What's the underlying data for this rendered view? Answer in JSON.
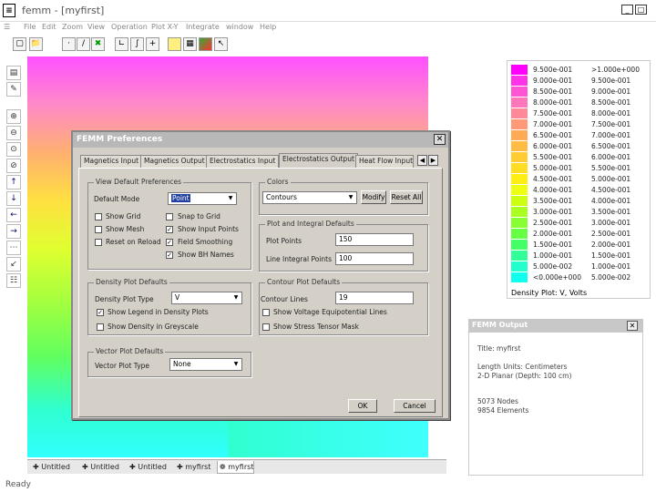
{
  "window": {
    "title": "femm - [myfirst]",
    "status": "Ready"
  },
  "menu": [
    "File",
    "Edit",
    "Zoom",
    "View",
    "Operation",
    "Plot X-Y",
    "Integrate",
    "window",
    "Help"
  ],
  "document_tabs": [
    "Untitled",
    "Untitled",
    "Untitled",
    "myfirst",
    "myfirst"
  ],
  "legend": {
    "rows": [
      {
        "low": "9.500e-001",
        "high": ">1.000e+000",
        "color": "#ff00ff"
      },
      {
        "low": "9.000e-001",
        "high": "9.500e-001",
        "color": "#ff33e8"
      },
      {
        "low": "8.500e-001",
        "high": "9.000e-001",
        "color": "#ff55d5"
      },
      {
        "low": "8.000e-001",
        "high": "8.500e-001",
        "color": "#ff77bb"
      },
      {
        "low": "7.500e-001",
        "high": "8.000e-001",
        "color": "#ff8899"
      },
      {
        "low": "7.000e-001",
        "high": "7.500e-001",
        "color": "#ff9977"
      },
      {
        "low": "6.500e-001",
        "high": "7.000e-001",
        "color": "#ffaa55"
      },
      {
        "low": "6.000e-001",
        "high": "6.500e-001",
        "color": "#ffbb44"
      },
      {
        "low": "5.500e-001",
        "high": "6.000e-001",
        "color": "#ffcc33"
      },
      {
        "low": "5.000e-001",
        "high": "5.500e-001",
        "color": "#ffdd22"
      },
      {
        "low": "4.500e-001",
        "high": "5.000e-001",
        "color": "#ffee11"
      },
      {
        "low": "4.000e-001",
        "high": "4.500e-001",
        "color": "#eeff11"
      },
      {
        "low": "3.500e-001",
        "high": "4.000e-001",
        "color": "#ccff11"
      },
      {
        "low": "3.000e-001",
        "high": "3.500e-001",
        "color": "#aaff22"
      },
      {
        "low": "2.500e-001",
        "high": "3.000e-001",
        "color": "#88ff33"
      },
      {
        "low": "2.000e-001",
        "high": "2.500e-001",
        "color": "#66ff44"
      },
      {
        "low": "1.500e-001",
        "high": "2.000e-001",
        "color": "#44ff66"
      },
      {
        "low": "1.000e-001",
        "high": "1.500e-001",
        "color": "#33ff99"
      },
      {
        "low": "5.000e-002",
        "high": "1.000e-001",
        "color": "#22ffcc"
      },
      {
        "low": "<0.000e+000",
        "high": "5.000e-002",
        "color": "#11ffee"
      }
    ],
    "caption": "Density Plot: V, Volts"
  },
  "output": {
    "title": "FEMM Output",
    "lines": [
      "Title: myfirst",
      "Length Units: Centimeters",
      "2-D Planar (Depth: 100 cm)",
      "5073 Nodes",
      "9854 Elements"
    ]
  },
  "dialog": {
    "title": "FEMM Preferences",
    "tabs": [
      "Magnetics Input",
      "Magnetics Output",
      "Electrostatics Input",
      "Electrostatics Output",
      "Heat Flow Input"
    ],
    "view": {
      "group": "View Default Preferences",
      "default_mode_label": "Default Mode",
      "default_mode": "Point",
      "show_grid": "Show Grid",
      "snap_to_grid": "Snap to Grid",
      "show_mesh": "Show Mesh",
      "show_input_points": "Show Input Points",
      "reset_on_reload": "Reset on Reload",
      "field_smoothing": "Field Smoothing",
      "show_bh_names": "Show BH Names"
    },
    "colors": {
      "group": "Colors",
      "selected": "Contours",
      "modify": "Modify",
      "reset_all": "Reset All"
    },
    "plot": {
      "group": "Plot and Integral Defaults",
      "plot_points_label": "Plot Points",
      "plot_points": "150",
      "line_integral_points_label": "Line Integral Points",
      "line_integral_points": "100"
    },
    "density": {
      "group": "Density Plot Defaults",
      "type_label": "Density Plot Type",
      "type": "V",
      "show_legend": "Show Legend in Density Plots",
      "greyscale": "Show Density in Greyscale"
    },
    "contour": {
      "group": "Contour Plot Defaults",
      "lines_label": "Contour Lines",
      "lines": "19",
      "equipotential": "Show Voltage Equipotential Lines",
      "stress": "Show Stress Tensor Mask"
    },
    "vector": {
      "group": "Vector Plot Defaults",
      "type_label": "Vector Plot Type",
      "type": "None"
    },
    "ok": "OK",
    "cancel": "Cancel"
  }
}
